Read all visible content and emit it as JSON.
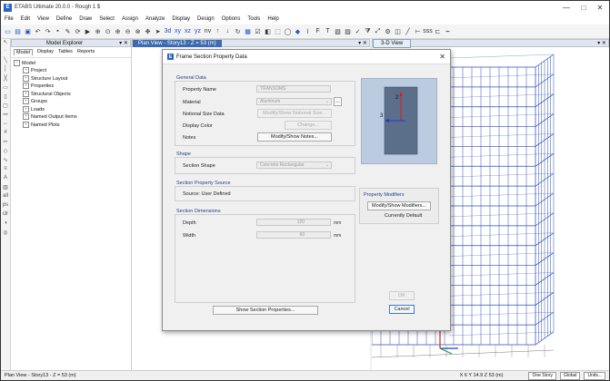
{
  "app": {
    "title": "ETABS Ultimate 20.0.0 - Rough 1 $",
    "icon": "E",
    "window_controls": [
      "—",
      "□",
      "✕"
    ]
  },
  "menu": [
    "File",
    "Edit",
    "View",
    "Define",
    "Draw",
    "Select",
    "Assign",
    "Analyze",
    "Display",
    "Design",
    "Options",
    "Tools",
    "Help"
  ],
  "explorer": {
    "title": "Model Explorer",
    "tabs": [
      "Model",
      "Display",
      "Tables",
      "Reports"
    ],
    "tree_root": "Model",
    "tree_items": [
      "Project",
      "Structure Layout",
      "Properties",
      "Structural Objects",
      "Groups",
      "Loads",
      "Named Output Items",
      "Named Plots"
    ]
  },
  "plan_view": {
    "tab": "Plan View - Story13 - Z = 53 (m)"
  },
  "view_3d": {
    "tab": "3-D View"
  },
  "status": {
    "left": "Plan View - Story13 - Z = 53 (m)",
    "coords": "X 6  Y 14.9  Z 53 (m)",
    "story": "One Story",
    "global": "Global",
    "units": "Units..."
  },
  "dialog": {
    "title": "Frame Section Property Data",
    "icon": "E",
    "general_data": {
      "title": "General Data",
      "property_name_label": "Property Name",
      "property_name_value": "TRANSOMS",
      "material_label": "Material",
      "material_value": "Aluminum",
      "material_button": "...",
      "notional_label": "Notional Size Data",
      "notional_button": "Modify/Show Notional Size...",
      "color_label": "Display Color",
      "color_button": "Change...",
      "notes_label": "Notes",
      "notes_button": "Modify/Show Notes..."
    },
    "shape": {
      "title": "Shape",
      "section_shape_label": "Section Shape",
      "section_shape_value": "Concrete Rectangular"
    },
    "source": {
      "title": "Section Property Source",
      "source_text": "Source:   User Defined"
    },
    "dimensions": {
      "title": "Section Dimensions",
      "depth_label": "Depth",
      "depth_value": "120",
      "depth_unit": "mm",
      "width_label": "Width",
      "width_value": "60",
      "width_unit": "mm"
    },
    "preview_axes": {
      "axis2": "2",
      "axis3": "3"
    },
    "modifiers": {
      "title": "Property Modifiers",
      "button": "Modify/Show Modifiers...",
      "status": "Currently Default"
    },
    "show_props_button": "Show Section Properties...",
    "ok_button": "OK",
    "cancel_button": "Cancel"
  },
  "colors": {
    "accent": "#2a64c8",
    "group_title": "#1d3f8a",
    "grid_line": "#2b4fb3",
    "section_fill": "#5c6f8a"
  }
}
